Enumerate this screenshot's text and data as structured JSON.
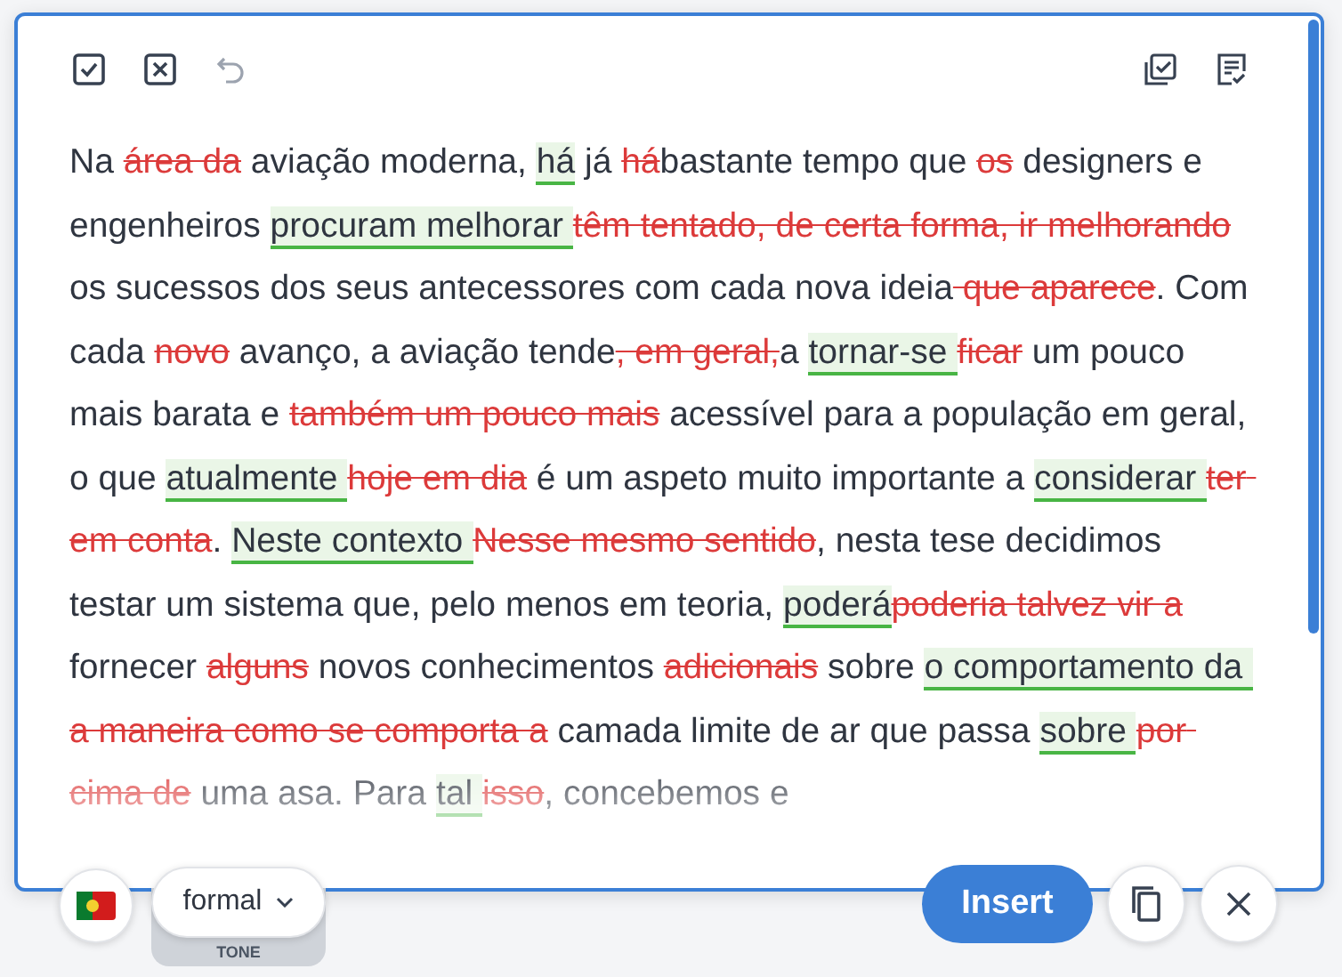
{
  "toolbar": {
    "undo": {
      "disabled": true
    }
  },
  "text": [
    {
      "kind": "plain",
      "text": "Na "
    },
    {
      "kind": "deleted",
      "text": "área da"
    },
    {
      "kind": "plain",
      "text": " aviação moderna, "
    },
    {
      "kind": "inserted",
      "text": "há"
    },
    {
      "kind": "plain",
      "text": " já "
    },
    {
      "kind": "deleted",
      "text": "há"
    },
    {
      "kind": "plain",
      "text": "bastante tempo que "
    },
    {
      "kind": "deleted",
      "text": "os"
    },
    {
      "kind": "plain",
      "text": " designers e engenheiros "
    },
    {
      "kind": "inserted",
      "text": "procuram melhorar "
    },
    {
      "kind": "deleted",
      "text": "têm tentado, de certa forma, ir melhorando"
    },
    {
      "kind": "plain",
      "text": " os sucessos dos seus antecessores com cada nova ideia"
    },
    {
      "kind": "deleted",
      "text": " que aparece"
    },
    {
      "kind": "plain",
      "text": ". Com cada "
    },
    {
      "kind": "deleted",
      "text": "novo"
    },
    {
      "kind": "plain",
      "text": " avanço, a aviação tende"
    },
    {
      "kind": "deleted",
      "text": ", em geral,"
    },
    {
      "kind": "plain",
      "text": "a "
    },
    {
      "kind": "inserted",
      "text": "tornar-se "
    },
    {
      "kind": "deleted",
      "text": "ficar"
    },
    {
      "kind": "plain",
      "text": " um pouco mais barata e "
    },
    {
      "kind": "deleted",
      "text": "também um pouco mais"
    },
    {
      "kind": "plain",
      "text": " acessível para a população em geral, o que "
    },
    {
      "kind": "inserted",
      "text": "atualmente "
    },
    {
      "kind": "deleted",
      "text": "hoje em dia"
    },
    {
      "kind": "plain",
      "text": " é um aspeto muito importante a "
    },
    {
      "kind": "inserted",
      "text": "considerar "
    },
    {
      "kind": "deleted",
      "text": "ter em conta"
    },
    {
      "kind": "plain",
      "text": ". "
    },
    {
      "kind": "inserted",
      "text": "Neste contexto "
    },
    {
      "kind": "deleted",
      "text": "Nesse mesmo sentido"
    },
    {
      "kind": "plain",
      "text": ", nesta tese decidimos testar um sistema que, pelo menos em teoria, "
    },
    {
      "kind": "inserted",
      "text": "poderá"
    },
    {
      "kind": "deleted",
      "text": "poderia talvez vir a"
    },
    {
      "kind": "plain",
      "text": " fornecer "
    },
    {
      "kind": "deleted",
      "text": "alguns"
    },
    {
      "kind": "plain",
      "text": " novos conhecimentos "
    },
    {
      "kind": "deleted",
      "text": "adicionais"
    },
    {
      "kind": "plain",
      "text": " sobre "
    },
    {
      "kind": "inserted",
      "text": "o comportamento da "
    },
    {
      "kind": "deleted",
      "text": "a maneira como se comporta a"
    },
    {
      "kind": "plain",
      "text": " camada limite de ar que passa "
    },
    {
      "kind": "inserted",
      "text": "sobre "
    },
    {
      "kind": "deleted",
      "text": "por cima de"
    },
    {
      "kind": "plain",
      "text": " uma asa. Para "
    },
    {
      "kind": "inserted",
      "text": "tal "
    },
    {
      "kind": "deleted",
      "text": "isso"
    },
    {
      "kind": "plain",
      "text": ", concebemos e"
    }
  ],
  "tone": {
    "value": "formal",
    "label": "TONE"
  },
  "insert_button": "Insert"
}
